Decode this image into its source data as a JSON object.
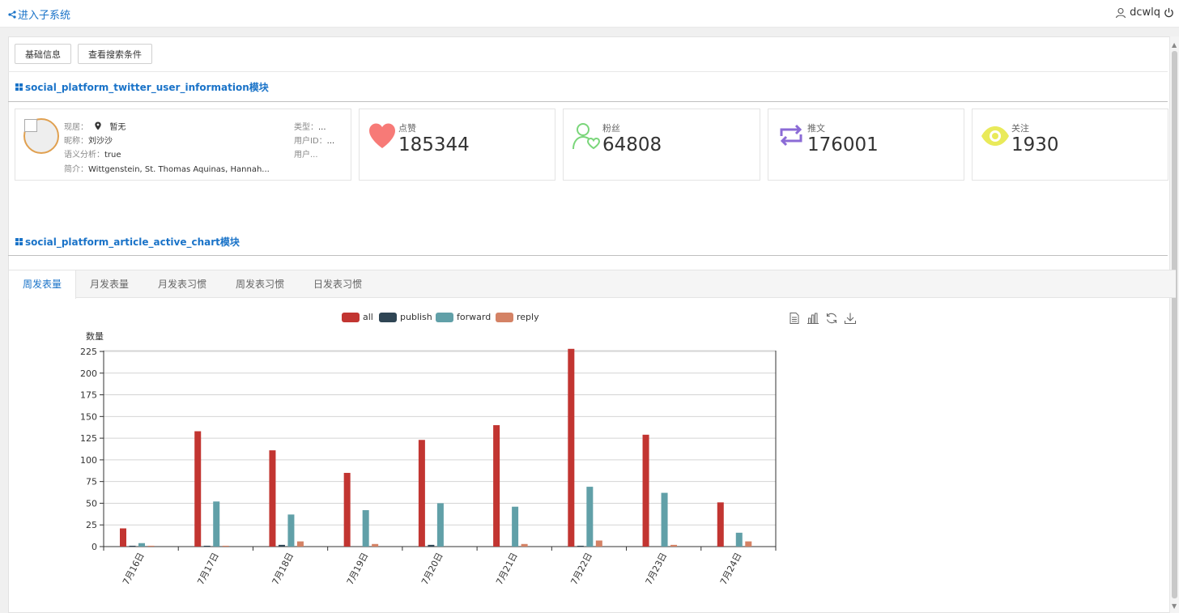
{
  "topbar": {
    "enter_label": "进入子系统",
    "username": "dcwlq"
  },
  "buttons": {
    "basic_info": "基础信息",
    "view_search": "查看搜索条件"
  },
  "sections": {
    "user_info_title": "social_platform_twitter_user_information模块",
    "chart_title": "social_platform_article_active_chart模块"
  },
  "profile": {
    "location_label": "现居：",
    "location_value": "暂无",
    "nickname_label": "昵称：",
    "nickname_value": "刘沙沙",
    "semantic_label": "语义分析：",
    "semantic_value": "true",
    "intro_label": "简介：",
    "intro_value": "Wittgenstein, St. Thomas Aquinas, Hannah...",
    "type_label": "类型：",
    "type_value": "...",
    "userid_label": "用户ID：",
    "userid_value": "...",
    "user_label": "用户..."
  },
  "stats": [
    {
      "label": "点赞",
      "value": "185344",
      "icon": "heart-icon",
      "color": "#f77a77"
    },
    {
      "label": "粉丝",
      "value": "64808",
      "icon": "follower-icon",
      "color": "#7ad67a"
    },
    {
      "label": "推文",
      "value": "176001",
      "icon": "retweet-icon",
      "color": "#8b6bd6"
    },
    {
      "label": "关注",
      "value": "1930",
      "icon": "eye-icon",
      "color": "#e9ea5a"
    }
  ],
  "tabs": [
    "周发表量",
    "月发表量",
    "月发表习惯",
    "周发表习惯",
    "日发表习惯"
  ],
  "chart_data": {
    "type": "bar",
    "ylabel": "数量",
    "xlabel": "",
    "ylim": [
      0,
      225
    ],
    "yticks": [
      0,
      25,
      50,
      75,
      100,
      125,
      150,
      175,
      200,
      225
    ],
    "categories": [
      "7月16日",
      "7月17日",
      "7月18日",
      "7月19日",
      "7月20日",
      "7月21日",
      "7月22日",
      "7月23日",
      "7月24日"
    ],
    "series": [
      {
        "name": "all",
        "color": "#c23531",
        "values": [
          21,
          133,
          111,
          85,
          123,
          140,
          228,
          129,
          51
        ]
      },
      {
        "name": "publish",
        "color": "#2f4554",
        "values": [
          1,
          1,
          2,
          0,
          2,
          0,
          1,
          0,
          0
        ]
      },
      {
        "name": "forward",
        "color": "#61a0a8",
        "values": [
          4,
          52,
          37,
          42,
          50,
          46,
          69,
          62,
          16
        ]
      },
      {
        "name": "reply",
        "color": "#d48265",
        "values": [
          1,
          1,
          6,
          3,
          0,
          3,
          7,
          2,
          6
        ]
      }
    ],
    "legend_position": "top-center",
    "grid": true
  }
}
